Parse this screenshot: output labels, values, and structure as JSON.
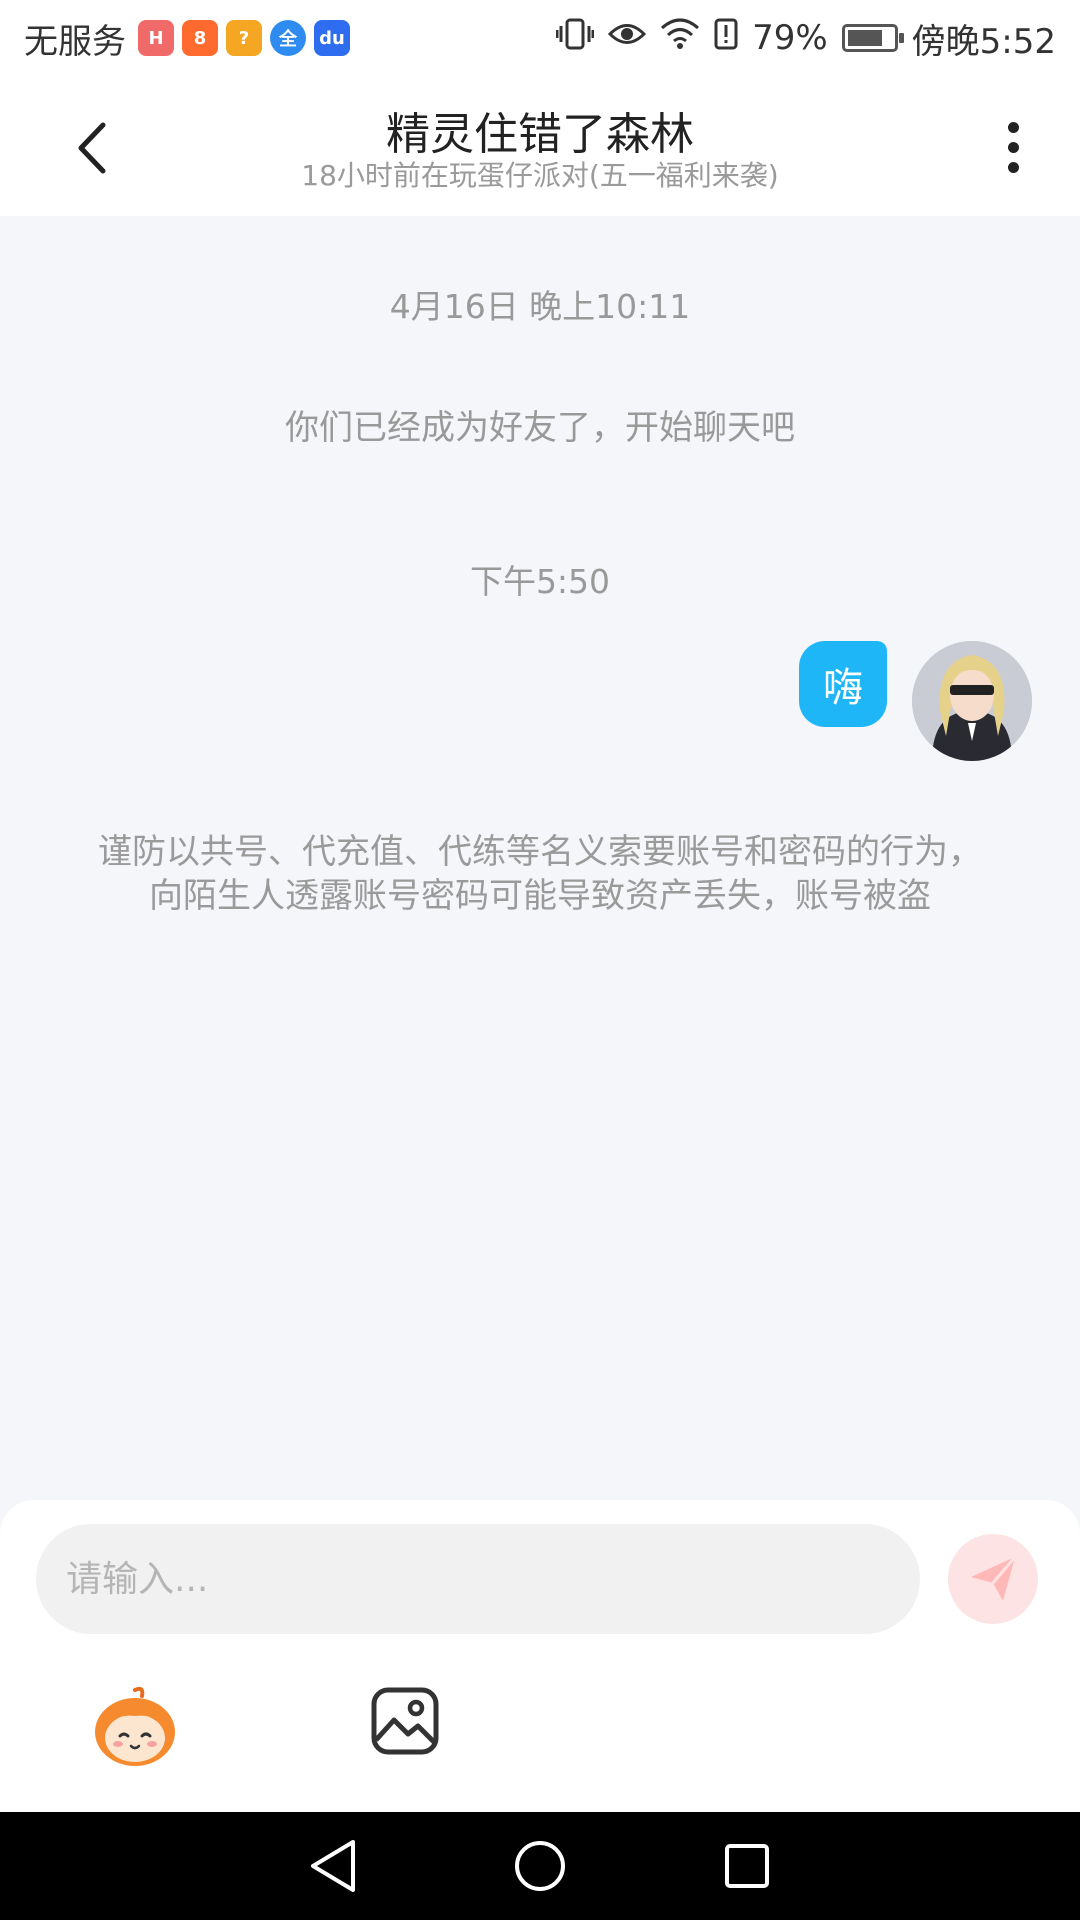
{
  "status_bar": {
    "carrier": "无服务",
    "battery_percent_label": "79%",
    "battery_level": 0.79,
    "time": "傍晚5:52",
    "app_icons": [
      "huawei-app-icon",
      "orange-app-icon",
      "yellow-app-icon",
      "quan-app-icon",
      "baidu-app-icon"
    ],
    "app_icon_colors": [
      "#f06a6a",
      "#ff6a2e",
      "#f5a623",
      "#2e8cf0",
      "#2f6df0"
    ],
    "app_icon_glyphs": [
      "H",
      "8",
      "?",
      "全",
      "du"
    ],
    "system_icons": [
      "vibrate-icon",
      "eye-icon",
      "wifi-icon",
      "alert-icon",
      "battery-icon"
    ]
  },
  "header": {
    "title": "精灵住错了森林",
    "subtitle": "18小时前在玩蛋仔派对(五一福利来袭)"
  },
  "chat": {
    "timestamp_1": "4月16日 晚上10:11",
    "system_message": "你们已经成为好友了，开始聊天吧",
    "timestamp_2": "下午5:50",
    "message_text": "嗨",
    "bubble_color": "#1fb6f7",
    "warning_text": "谨防以共号、代充值、代练等名义索要账号和密码的行为，向陌生人透露账号密码可能导致资产丢失，账号被盗"
  },
  "input": {
    "placeholder": "请输入..."
  },
  "colors": {
    "page_bg": "#f4f6f9",
    "send_button_bg": "#fde3e3",
    "send_icon": "#ffb8b8"
  }
}
